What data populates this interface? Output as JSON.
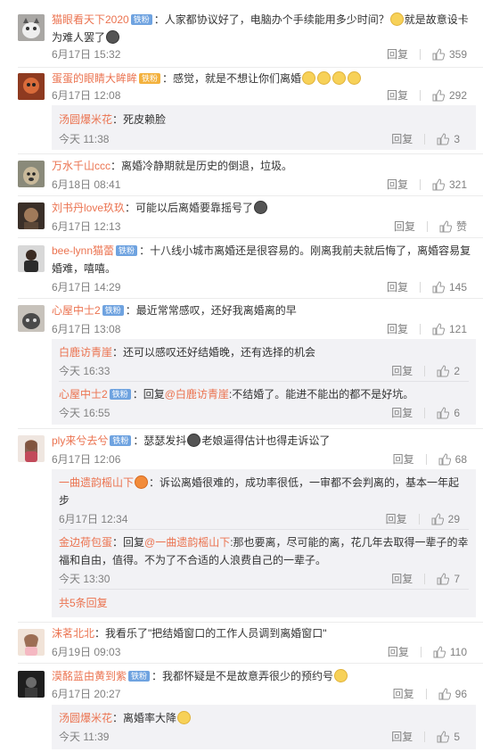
{
  "comments": [
    {
      "user": "猫眼看天下2020",
      "badge": "铁粉",
      "text": "：人家都协议好了，电脑办个手续能用多少时间？",
      "text2": "就是故意设卡为难人罢了",
      "time": "6月17日 15:32",
      "reply": "回复",
      "likes": "359"
    },
    {
      "user": "蛋蛋的眼睛大眸眸",
      "badge": "铁粉",
      "text": "：感觉，就是不想让你们离婚",
      "time": "6月17日 12:08",
      "reply": "回复",
      "likes": "292",
      "subs": [
        {
          "user": "汤圆爆米花",
          "text": "：死皮赖脸",
          "time": "今天 11:38",
          "reply": "回复",
          "likes": "3"
        }
      ]
    },
    {
      "user": "万水千山ccc",
      "text": "：离婚冷静期就是历史的倒退，垃圾。",
      "time": "6月18日 08:41",
      "reply": "回复",
      "likes": "321"
    },
    {
      "user": "刘书丹love玖玖",
      "text": "：可能以后离婚要靠摇号了",
      "time": "6月17日 12:13",
      "reply": "回复",
      "likes": "赞"
    },
    {
      "user": "bee-lynn猫蕾",
      "badge": "铁粉",
      "text": "：十八线小城市离婚还是很容易的。刚离我前夫就后悔了，离婚容易复婚难，嘻嘻。",
      "time": "6月17日 14:29",
      "reply": "回复",
      "likes": "145"
    },
    {
      "user": "心屋中士2",
      "badge": "铁粉",
      "text": "：最近常常感叹，还好我离婚离的早",
      "time": "6月17日 13:08",
      "reply": "回复",
      "likes": "121",
      "subs": [
        {
          "user": "白鹿访青崖",
          "text": "：还可以感叹还好结婚晚，还有选择的机会",
          "time": "今天 16:33",
          "reply": "回复",
          "likes": "2"
        },
        {
          "user": "心屋中士2",
          "badge": "铁粉",
          "text_pre": "：回复",
          "mention": "@白鹿访青崖",
          "text": ":不结婚了。能进不能出的都不是好坑。",
          "time": "今天 16:55",
          "reply": "回复",
          "likes": "6"
        }
      ]
    },
    {
      "user": "ply来兮去兮",
      "badge": "铁粉",
      "text": "：瑟瑟发抖",
      "text2": "老娘逼得估计也得走诉讼了",
      "time": "6月17日 12:06",
      "reply": "回复",
      "likes": "68",
      "subs": [
        {
          "user": "一曲遗韵榣山下",
          "text": "：诉讼离婚很难的，成功率很低，一审都不会判离的，基本一年起步",
          "time": "6月17日 12:34",
          "reply": "回复",
          "likes": "29"
        },
        {
          "user": "金边荷包蛋",
          "text_pre": "：回复",
          "mention": "@一曲遗韵榣山下",
          "text": ":那也要离，尽可能的离，花几年去取得一辈子的幸福和自由，值得。不为了不合适的人浪费自己的一辈子。",
          "time": "今天 13:30",
          "reply": "回复",
          "likes": "7"
        }
      ],
      "more": "共5条回复"
    },
    {
      "user": "沫茗北北",
      "text": "：我看乐了\"把结婚窗口的工作人员调到离婚窗口\"",
      "time": "6月19日 09:03",
      "reply": "回复",
      "likes": "110"
    },
    {
      "user": "漠酩蓝由黄到紫",
      "badge": "铁粉",
      "text": "：我都怀疑是不是故意弄很少的预约号",
      "time": "6月17日 20:27",
      "reply": "回复",
      "likes": "96",
      "subs": [
        {
          "user": "汤圆爆米花",
          "text": "：离婚率大降",
          "time": "今天 11:39",
          "reply": "回复",
          "likes": "5"
        }
      ]
    }
  ]
}
